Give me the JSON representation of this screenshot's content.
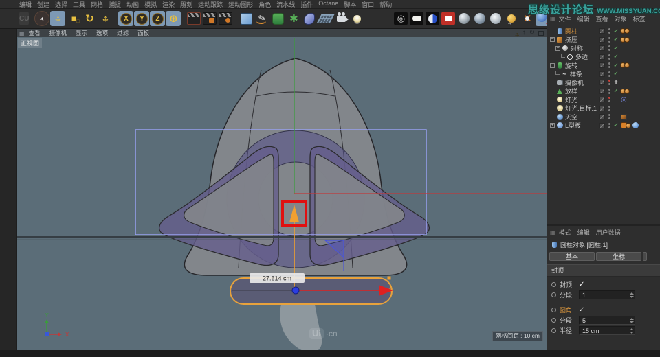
{
  "app": {
    "watermark_main": "思缘设计论坛",
    "watermark_url": "WWW.MISSYUAN.COM",
    "logo": "CU"
  },
  "colors": {
    "viewport_bg": "#5b6d78",
    "selection_orange": "#e8a23c",
    "axis_red": "#c03a3a",
    "axis_green": "#3a9e3a",
    "highlight_red": "#e01010",
    "selection_blue": "#97a0ef",
    "watermark_teal": "#3aa39d"
  },
  "menubar": {
    "items": [
      "编辑",
      "创建",
      "选择",
      "工具",
      "网格",
      "捕捉",
      "动画",
      "模拟",
      "渲染",
      "雕刻",
      "运动跟踪",
      "运动图形",
      "角色",
      "流水线",
      "插件",
      "Octane",
      "脚本",
      "窗口",
      "帮助"
    ]
  },
  "toolbar": {
    "tools": [
      {
        "name": "live-selection-tool",
        "kind": "cursor",
        "gap": true
      },
      {
        "name": "move-tool",
        "kind": "move",
        "active": true
      },
      {
        "name": "scale-tool",
        "kind": "scale"
      },
      {
        "name": "rotate-tool",
        "kind": "rotate"
      },
      {
        "name": "last-used-tool",
        "kind": "move2"
      },
      {
        "name": "lock-x-axis",
        "kind": "axis",
        "label": "X",
        "active": true,
        "gap": true
      },
      {
        "name": "lock-y-axis",
        "kind": "axis",
        "label": "Y",
        "active": true
      },
      {
        "name": "lock-z-axis",
        "kind": "axis",
        "label": "Z",
        "active": true
      },
      {
        "name": "coordinate-system",
        "kind": "globe",
        "active": true
      },
      {
        "name": "render-active-view",
        "kind": "clap1",
        "gap": true
      },
      {
        "name": "render-picture-viewer",
        "kind": "clap2"
      },
      {
        "name": "render-settings",
        "kind": "clap3"
      },
      {
        "name": "primitive-cube-menu",
        "kind": "cube",
        "gap": true
      },
      {
        "name": "spline-pen-menu",
        "kind": "pen"
      },
      {
        "name": "subdivision-surface-menu",
        "kind": "subdiv"
      },
      {
        "name": "generators-menu",
        "kind": "array"
      },
      {
        "name": "deformers-menu",
        "kind": "shell"
      },
      {
        "name": "environment-menu",
        "kind": "floor"
      },
      {
        "name": "camera-menu",
        "kind": "cam"
      },
      {
        "name": "light-menu",
        "kind": "bulb"
      },
      {
        "name": "record-button",
        "kind": "target",
        "gap2": true
      },
      {
        "name": "keyframe-box",
        "kind": "whiterect"
      },
      {
        "name": "render-region-toggle",
        "kind": "half"
      },
      {
        "name": "render-active-object",
        "kind": "redcam"
      },
      {
        "name": "shading-sphere-1",
        "kind": "sphere1"
      },
      {
        "name": "shading-sphere-2",
        "kind": "sphere2"
      },
      {
        "name": "shading-sphere-3",
        "kind": "sphere3"
      },
      {
        "name": "coordinates-manager",
        "kind": "ballxyz"
      },
      {
        "name": "axis-modification",
        "kind": "crossx"
      },
      {
        "name": "global-translate",
        "kind": "bluearrow",
        "active": true
      }
    ]
  },
  "viewport": {
    "menu": [
      "查看",
      "摄像机",
      "显示",
      "选项",
      "过滤",
      "面板"
    ],
    "view_label": "正视图",
    "measurement": "27.614 cm",
    "grid_label": "网格间距 : 10 cm",
    "ui_watermark": {
      "logo": "Ui",
      "suffix": "·cn"
    },
    "axis": {
      "x": "X",
      "y": "Y"
    }
  },
  "object_manager": {
    "menu": [
      "文件",
      "编辑",
      "查看",
      "对象",
      "标签"
    ],
    "objects": [
      {
        "name": "圆柱",
        "icon": "cylinder",
        "indent": 0,
        "expander": "none",
        "selected": true,
        "check": "on",
        "tags": [
          "mat",
          "mat"
        ],
        "dots": "gray"
      },
      {
        "name": "挤压",
        "icon": "extrude",
        "indent": 0,
        "expander": "minus",
        "selected": false,
        "check": "on",
        "tags": [
          "mat",
          "mat"
        ],
        "dots": "gray"
      },
      {
        "name": "对称",
        "icon": "symmetry",
        "indent": 1,
        "expander": "minus",
        "selected": false,
        "check": "on",
        "tags": [],
        "dots": "gray"
      },
      {
        "name": "多边",
        "icon": "nside",
        "indent": 2,
        "expander": "end",
        "selected": false,
        "check": "on",
        "tags": [],
        "dots": "gray"
      },
      {
        "name": "旋转",
        "icon": "lathe",
        "indent": 0,
        "expander": "minus",
        "selected": false,
        "check": "on",
        "tags": [
          "mat",
          "mat"
        ],
        "dots": "gray"
      },
      {
        "name": "样条",
        "icon": "spline",
        "indent": 1,
        "expander": "end",
        "selected": false,
        "check": "on",
        "tags": [],
        "dots": "gray"
      },
      {
        "name": "摄像机",
        "icon": "camera",
        "indent": 0,
        "expander": "none",
        "selected": false,
        "check": "cross",
        "tags": [],
        "dots": "red"
      },
      {
        "name": "放样",
        "icon": "loft",
        "indent": 0,
        "expander": "none",
        "selected": false,
        "check": "on",
        "tags": [
          "mat",
          "mat"
        ],
        "dots": "gray"
      },
      {
        "name": "灯光",
        "icon": "light",
        "indent": 0,
        "expander": "none",
        "selected": false,
        "check": "off",
        "tags": [
          "target"
        ],
        "dots": "red"
      },
      {
        "name": "灯光.目标.1",
        "icon": "light-target",
        "indent": 0,
        "expander": "none",
        "selected": false,
        "check": "off",
        "tags": [],
        "dots": "gray"
      },
      {
        "name": "天空",
        "icon": "sky",
        "indent": 0,
        "expander": "none",
        "selected": false,
        "check": "off",
        "tags": [
          "texture"
        ],
        "dots": "gray"
      },
      {
        "name": "L型板",
        "icon": "l-plate",
        "indent": 0,
        "expander": "plus",
        "selected": false,
        "check": "on",
        "tags": [
          "orangesq",
          "mat",
          "phong"
        ],
        "dots": "gray"
      }
    ]
  },
  "attribute_manager": {
    "menu": [
      "模式",
      "编辑",
      "用户数据"
    ],
    "object_title": "圆柱对象 [圆柱.1]",
    "tabs": [
      "基本",
      "坐标"
    ],
    "section": "封顶",
    "rows": [
      {
        "name": "caps-toggle",
        "label": "封顶",
        "type": "check",
        "checked": true,
        "highlight": false,
        "gap": false
      },
      {
        "name": "cap-segments",
        "label": "分段",
        "type": "input",
        "value": "1",
        "highlight": false,
        "gap": false
      },
      {
        "name": "fillet-toggle",
        "label": "圆角",
        "type": "check",
        "checked": true,
        "highlight": true,
        "gap": true
      },
      {
        "name": "fillet-segments",
        "label": "分段",
        "type": "input",
        "value": "5",
        "highlight": false,
        "gap": false
      },
      {
        "name": "fillet-radius",
        "label": "半径",
        "type": "input",
        "value": "15 cm",
        "highlight": false,
        "gap": false
      }
    ]
  }
}
